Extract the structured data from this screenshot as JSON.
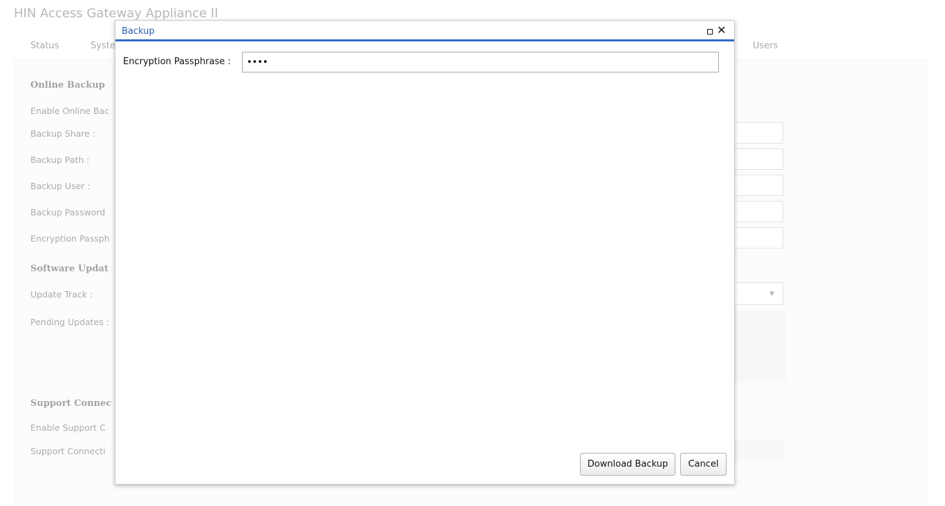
{
  "app": {
    "title": "HIN Access Gateway Appliance II"
  },
  "tabs": [
    {
      "label": "Status"
    },
    {
      "label": "Syste"
    },
    {
      "label": "Users"
    }
  ],
  "background": {
    "online_backup": {
      "title": "Online Backup",
      "fields": [
        {
          "label": "Enable Online Bac"
        },
        {
          "label": "Backup Share :"
        },
        {
          "label": "Backup Path :"
        },
        {
          "label": "Backup User :"
        },
        {
          "label": "Backup Password"
        },
        {
          "label": "Encryption Passph"
        }
      ]
    },
    "software_update": {
      "title": "Software Updat",
      "fields": [
        {
          "label": "Update Track :"
        },
        {
          "label": "Pending Updates :"
        }
      ]
    },
    "support_connection": {
      "title": "Support Connec",
      "fields": [
        {
          "label": "Enable Support C"
        },
        {
          "label": "Support Connecti"
        }
      ]
    }
  },
  "dialog": {
    "title": "Backup",
    "passphrase_label": "Encryption Passphrase :",
    "passphrase_value": "1234",
    "download_label": "Download Backup",
    "cancel_label": "Cancel",
    "header_color": "#2d6bc4"
  }
}
